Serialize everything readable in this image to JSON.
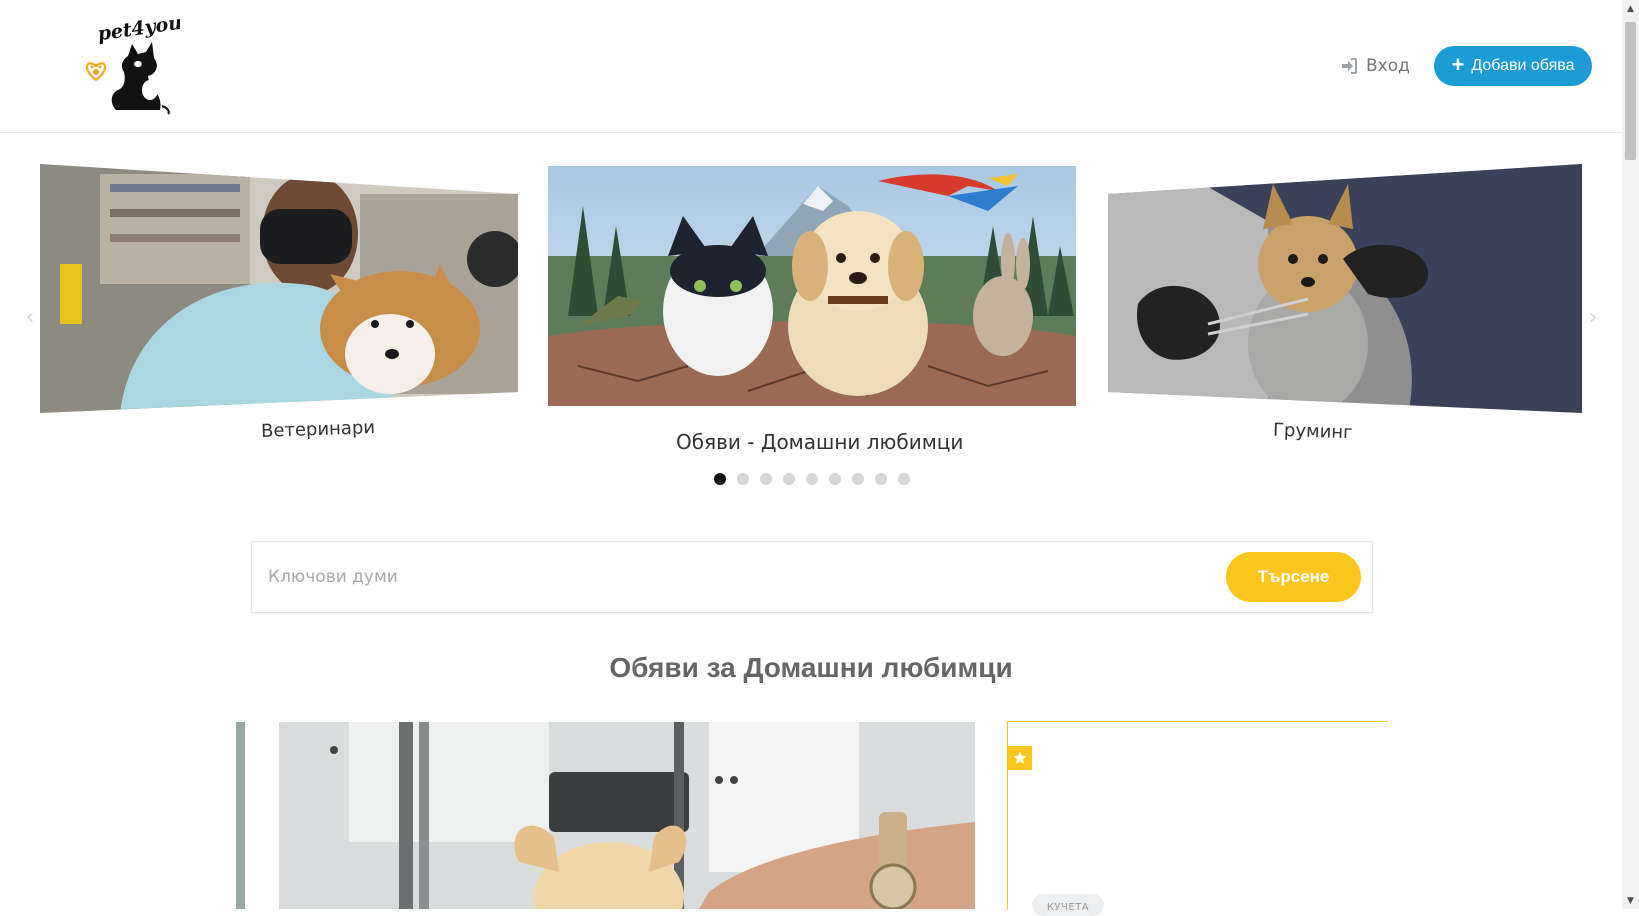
{
  "brand": {
    "logo_text": "pet4you"
  },
  "header": {
    "login_label": "Вход",
    "add_listing_label": "Добави обява"
  },
  "carousel": {
    "slides": [
      {
        "caption": "Ветеринари"
      },
      {
        "caption": "Обяви - Домашни любимци"
      },
      {
        "caption": "Груминг"
      }
    ],
    "dot_count": 9,
    "active_dot": 1
  },
  "search": {
    "placeholder": "Ключови думи",
    "value": "",
    "button_label": "Търсене"
  },
  "listings": {
    "title": "Обяви за Домашни любимци",
    "featured_category": "КУЧЕТА"
  },
  "colors": {
    "primary_blue": "#1d9bd7",
    "accent_yellow": "#fbc51b",
    "active_dot": "#111111",
    "inactive_dot": "#d6d6d6"
  },
  "icons": {
    "login": "sign-in-icon",
    "add": "plus-icon",
    "featured": "star-icon",
    "prev": "chevron-left-icon",
    "next": "chevron-right-icon"
  }
}
